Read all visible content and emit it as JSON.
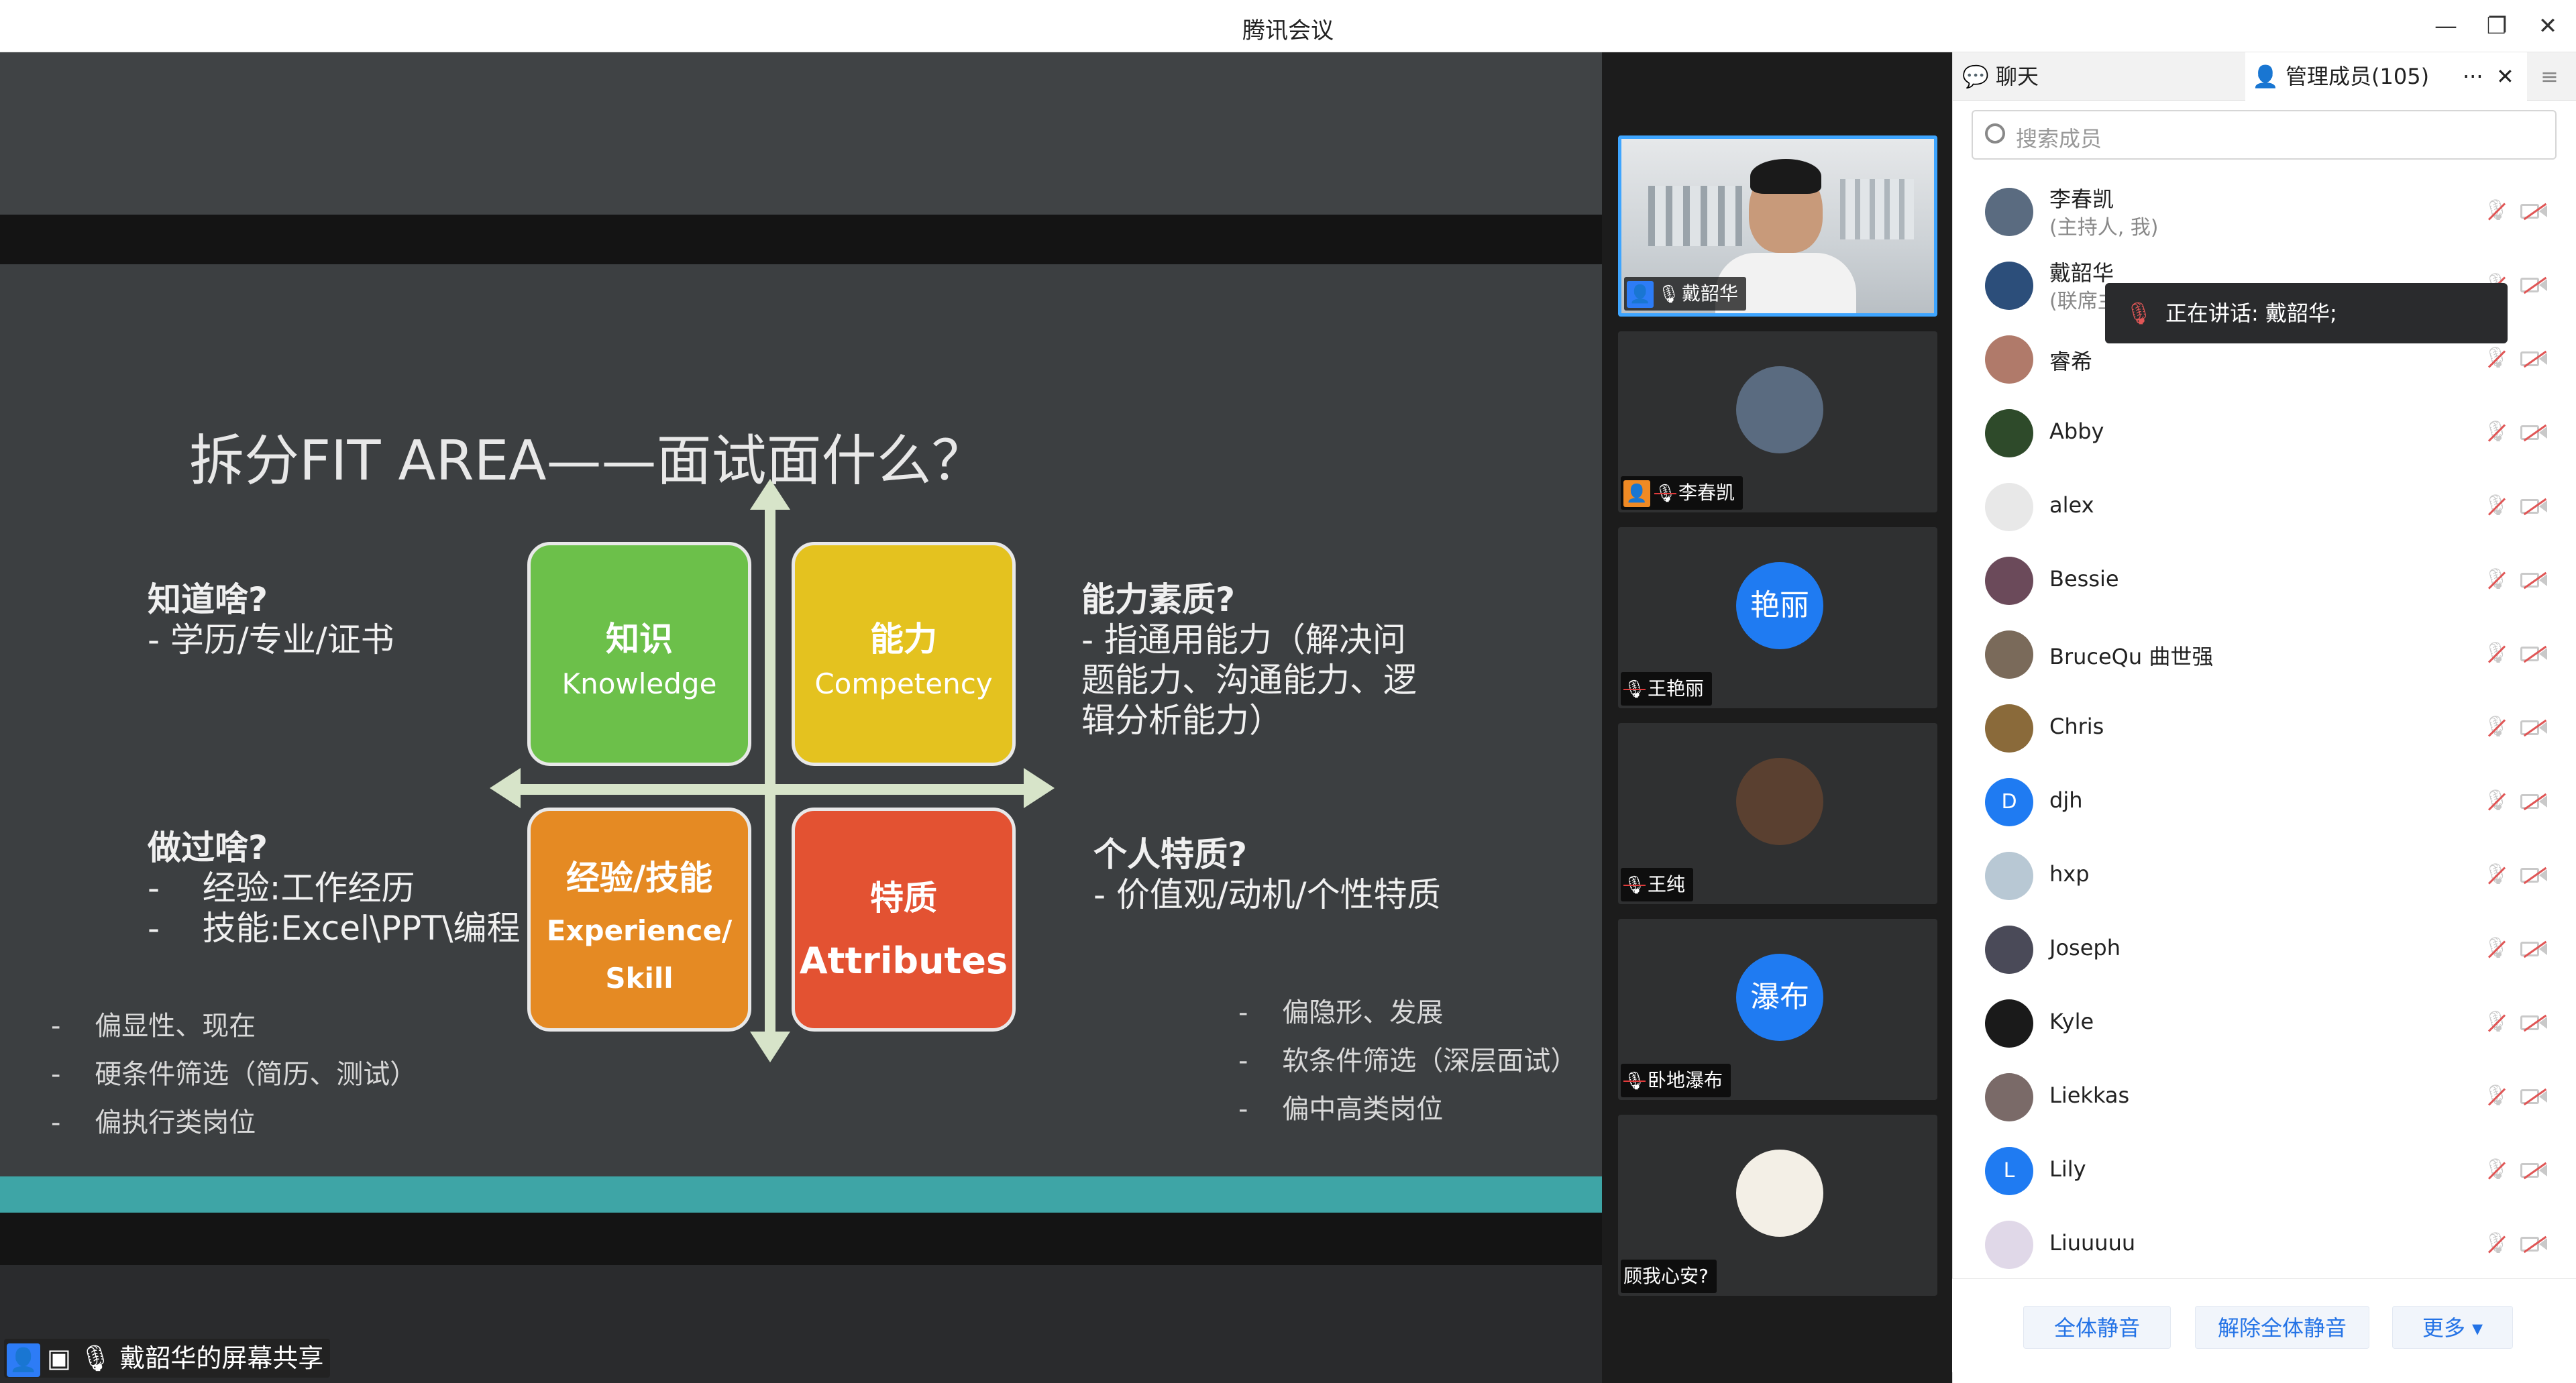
{
  "window": {
    "title": "腾讯会议",
    "minimize": "—",
    "restore": "❐",
    "close": "✕"
  },
  "slide": {
    "title": "拆分FIT AREA——面试面什么？",
    "quadrants": [
      {
        "cn": "知识",
        "en": "Knowledge",
        "color": "#6cc04a"
      },
      {
        "cn": "能力",
        "en": "Competency",
        "color": "#e4c21f"
      },
      {
        "cn": "经验/技能",
        "en": "Experience/",
        "en2": "Skill",
        "color": "#e58a23"
      },
      {
        "cn": "特质",
        "en": "Attributes",
        "color": "#e35232"
      }
    ],
    "left_top": {
      "heading": "知道啥?",
      "line1": "- 学历/专业/证书"
    },
    "left_bottom": {
      "heading": "做过啥?",
      "line1": "-    经验:工作经历",
      "line2": "-    技能:Excel\\PPT\\编程"
    },
    "right_top": {
      "heading": "能力素质?",
      "line1": "- 指通用能力（解决问",
      "line2": "题能力、沟通能力、逻",
      "line3": "辑分析能力）"
    },
    "right_bottom": {
      "heading": "个人特质?",
      "line1": "- 价值观/动机/个性特质"
    },
    "left_notes": [
      "-    偏显性、现在",
      "-    硬条件筛选（简历、测试）",
      "-    偏执行类岗位"
    ],
    "right_notes": [
      "-    偏隐形、发展",
      "-    软条件筛选（深层面试）",
      "-    偏中高类岗位"
    ]
  },
  "share_label": "戴韶华的屏幕共享",
  "gallery": [
    {
      "name": "戴韶华",
      "type": "camera",
      "mic": "on"
    },
    {
      "name": "李春凯",
      "type": "photo",
      "mic": "off"
    },
    {
      "name": "王艳丽",
      "type": "initials",
      "initials": "艳丽",
      "mic": "off"
    },
    {
      "name": "王纯",
      "type": "photo",
      "mic": "off"
    },
    {
      "name": "卧地瀑布",
      "type": "initials",
      "initials": "瀑布",
      "mic": "off"
    },
    {
      "name": "顾我心安?",
      "type": "photo",
      "mic": "none"
    }
  ],
  "panel": {
    "tab_chat": "聊天",
    "tab_members": "管理成员(105)",
    "more": "···",
    "close": "✕",
    "menu": "≡",
    "search_placeholder": "搜索成员",
    "tooltip": "正在讲话: 戴韶华;",
    "members": [
      {
        "name": "李春凯",
        "sub": "(主持人, 我)",
        "avatar_color": "#5a6b80"
      },
      {
        "name": "戴韶华",
        "sub": "(联席主持人)",
        "avatar_color": "#2c4e7a"
      },
      {
        "name": "睿希",
        "sub": "",
        "avatar_color": "#b07a6a"
      },
      {
        "name": "Abby",
        "sub": "",
        "avatar_color": "#2e4a2a"
      },
      {
        "name": "alex",
        "sub": "",
        "avatar_color": "#e8e8e8"
      },
      {
        "name": "Bessie",
        "sub": "",
        "avatar_color": "#6b4a5a"
      },
      {
        "name": "BruceQu 曲世强",
        "sub": "",
        "avatar_color": "#7a6a5a"
      },
      {
        "name": "Chris",
        "sub": "",
        "avatar_color": "#8a6a3a"
      },
      {
        "name": "djh",
        "sub": "",
        "avatar_color": "#1f7bf2",
        "initial": "D"
      },
      {
        "name": "hxp",
        "sub": "",
        "avatar_color": "#b8c8d4"
      },
      {
        "name": "Joseph",
        "sub": "",
        "avatar_color": "#4a4a58"
      },
      {
        "name": "Kyle",
        "sub": "",
        "avatar_color": "#1a1a1a"
      },
      {
        "name": "Liekkas",
        "sub": "",
        "avatar_color": "#7a6a68"
      },
      {
        "name": "Lily",
        "sub": "",
        "avatar_color": "#1f7bf2",
        "initial": "L"
      },
      {
        "name": "Liuuuuu",
        "sub": "",
        "avatar_color": "#e0d8e8"
      }
    ],
    "footer": {
      "mute_all": "全体静音",
      "unmute_all": "解除全体静音",
      "more": "更多 ▾"
    }
  }
}
